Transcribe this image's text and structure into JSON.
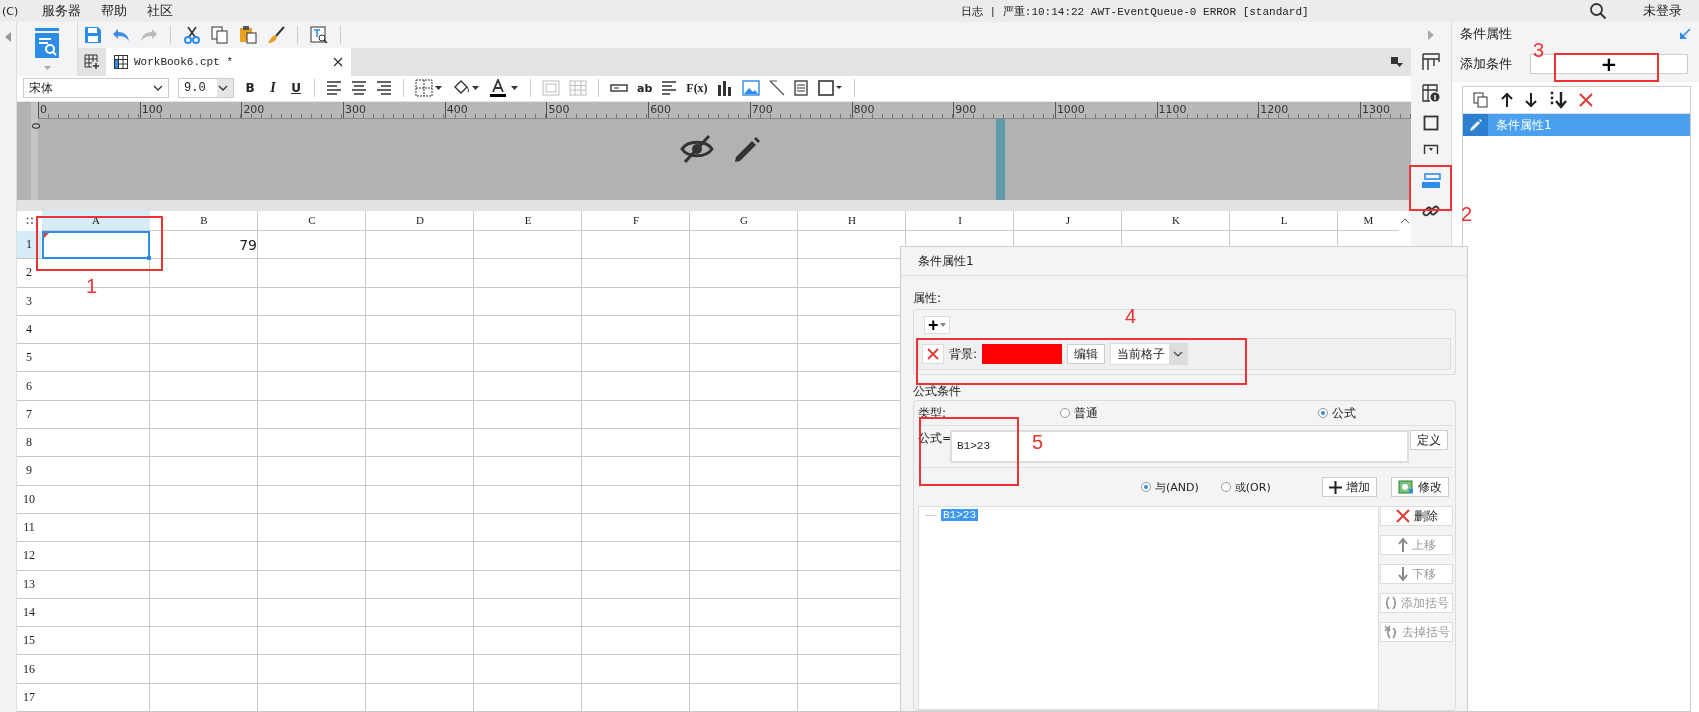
{
  "menu_bar": {
    "app_mark": "(C)",
    "items": [
      "服务器",
      "帮助",
      "社区"
    ],
    "log": "日志 | 严重:10:14:22 AWT-EventQueue-0 ERROR [standard]",
    "login": "未登录"
  },
  "file_tab": {
    "label": "WorkBook6.cpt *"
  },
  "format_toolbar": {
    "font": "宋体",
    "size": "9.0",
    "style_buttons": [
      "B",
      "I",
      "U"
    ],
    "text_buttons": [
      "ab",
      "F(x)"
    ]
  },
  "ruler": {
    "vertical_label": "0",
    "ticks": [
      "0",
      "100",
      "200",
      "300",
      "400",
      "500",
      "600",
      "700",
      "800",
      "900",
      "1000",
      "1100",
      "1200",
      "1300"
    ]
  },
  "sheet": {
    "columns": [
      {
        "label": "A",
        "selected": true
      },
      {
        "label": "B",
        "selected": false
      },
      {
        "label": "C",
        "selected": false
      },
      {
        "label": "D",
        "selected": false
      },
      {
        "label": "E",
        "selected": false
      },
      {
        "label": "F",
        "selected": false
      },
      {
        "label": "G",
        "selected": false
      },
      {
        "label": "H",
        "selected": false
      },
      {
        "label": "I",
        "selected": false
      },
      {
        "label": "J",
        "selected": false
      },
      {
        "label": "K",
        "selected": false
      },
      {
        "label": "L",
        "selected": false
      },
      {
        "label": "M",
        "selected": false
      }
    ],
    "rows": [
      {
        "label": "1",
        "selected": true,
        "cells": [
          {
            "selected": true
          },
          {
            "selected": false,
            "text": "79"
          }
        ]
      },
      {
        "label": "2",
        "selected": false
      },
      {
        "label": "3",
        "selected": false
      },
      {
        "label": "4",
        "selected": false
      },
      {
        "label": "5",
        "selected": false
      },
      {
        "label": "6",
        "selected": false
      },
      {
        "label": "7",
        "selected": false
      },
      {
        "label": "8",
        "selected": false
      },
      {
        "label": "9",
        "selected": false
      },
      {
        "label": "10",
        "selected": false
      },
      {
        "label": "11",
        "selected": false
      },
      {
        "label": "12",
        "selected": false
      },
      {
        "label": "13",
        "selected": false
      },
      {
        "label": "14",
        "selected": false
      },
      {
        "label": "15",
        "selected": false
      },
      {
        "label": "16",
        "selected": false
      },
      {
        "label": "17",
        "selected": false
      }
    ]
  },
  "right_panel": {
    "title": "条件属性",
    "add_label": "添加条件",
    "add_button": "+",
    "conditions": [
      {
        "label": "条件属性1",
        "selected": true
      }
    ]
  },
  "dialog": {
    "title": "条件属性1",
    "attributes": {
      "legend": "属性:",
      "add_button": "+",
      "items": [
        {
          "label": "背景:",
          "color": "#ff0000",
          "edit_button": "编辑",
          "scope": "当前格子"
        }
      ]
    },
    "formula_condition": {
      "legend": "公式条件",
      "type_label": "类型:",
      "types": [
        {
          "label": "普通",
          "selected": false
        },
        {
          "label": "公式",
          "selected": true
        }
      ],
      "formula_label": "公式=",
      "formula": "B1>23",
      "define_button": "定义",
      "logic": [
        {
          "label": "与(AND)",
          "selected": true
        },
        {
          "label": "或(OR)",
          "selected": false
        }
      ],
      "add_button": "增加",
      "modify_button": "修改",
      "conditions": [
        {
          "text": "B1>23",
          "selected": true
        }
      ],
      "side_buttons": [
        {
          "kind": "delete",
          "label": "删除",
          "disabled": false
        },
        {
          "kind": "up",
          "label": "上移",
          "disabled": true
        },
        {
          "kind": "down",
          "label": "下移",
          "disabled": true
        },
        {
          "kind": "add-paren",
          "label": "添加括号",
          "disabled": true
        },
        {
          "kind": "remove-paren",
          "label": "去掉括号",
          "disabled": true
        }
      ]
    }
  },
  "annotations": [
    "1",
    "2",
    "3",
    "4",
    "5"
  ]
}
